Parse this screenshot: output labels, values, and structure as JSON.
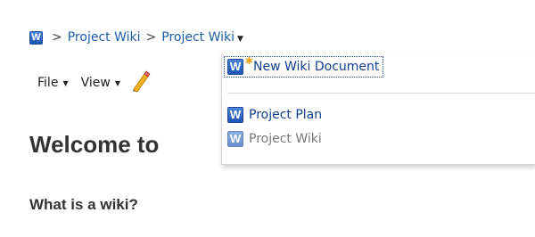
{
  "breadcrumb": {
    "site_icon_letter": "W",
    "separator": ">",
    "items": [
      "Project Wiki",
      "Project Wiki"
    ]
  },
  "toolbar": {
    "file_label": "File",
    "view_label": "View"
  },
  "page": {
    "heading": "Welcome to",
    "subheading": "What is a wiki?"
  },
  "dropdown": {
    "new_label": "New Wiki Document",
    "items": [
      "Project Plan",
      "Project Wiki"
    ]
  },
  "colors": {
    "link_blue": "#1b5ea8",
    "icon_blue": "#2c63c0"
  }
}
